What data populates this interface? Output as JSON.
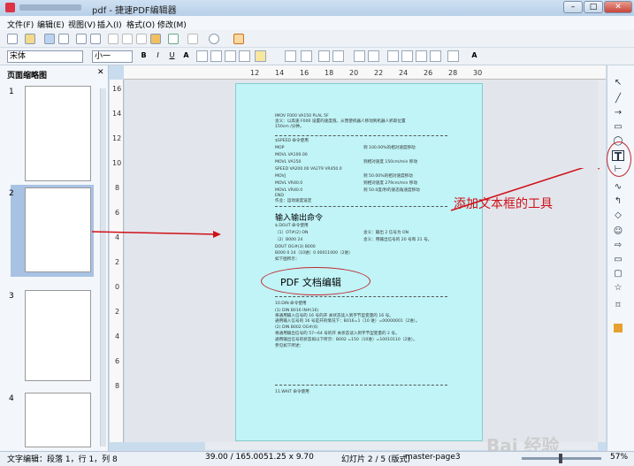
{
  "window": {
    "title": "pdf - 捷速PDF编辑器",
    "minimize": "–",
    "maximize": "□",
    "close": "✕"
  },
  "menu": [
    "文件(F)",
    "编辑(E)",
    "视图(V)",
    "插入(I)",
    "格式(O)",
    "修改(M)"
  ],
  "format": {
    "font": "宋体",
    "size": "小一",
    "bold": "B",
    "italic": "I",
    "underline": "U",
    "fontscale": "A"
  },
  "left_pane": {
    "title": "页面缩略图",
    "pages": [
      "1",
      "2",
      "3",
      "4"
    ],
    "selected": "2"
  },
  "ruler": {
    "h": [
      "12",
      "14",
      "16",
      "18",
      "20",
      "22",
      "24",
      "26",
      "28",
      "30"
    ],
    "v": [
      "16",
      "14",
      "12",
      "10",
      "8",
      "6",
      "4",
      "2",
      "0",
      "2",
      "4",
      "6",
      "8"
    ]
  },
  "page": {
    "heading": "输入输出命令",
    "pdf_text": "PDF 文档编辑",
    "lines_top": [
      "IMOV F000 VA150 PLAL 5F",
      "含义：以高速 F000 设置的速度值。从而使机器人移动到机器人抓取位置",
      "150cm /分钟。",
      "$SPEED 命令使用",
      "MOP",
      "MOVL VA100.00",
      "MOVL VA150",
      "SPEED VA200.00 VA279 VR450.0",
      "MOVJ",
      "MOVL VR40.0",
      "MOVL VR40.0",
      "END",
      "作业：运动速度设定"
    ],
    "right_col": [
      "到 100.00%的相对速度移动",
      "到相对速度 150cm/min 移动",
      "到 50.00%的相对速度移动",
      "到相对速度 279cm/min 移动",
      "到 50.0度/秒的姿态角速度移动"
    ],
    "lines_io": [
      "$.DOUT 命令使用",
      "（1）OT#(2) ON",
      "（2）B000 24",
      "DOUT OG#(3) B000",
      "B000 0 24（10进）0 00011000（2进）",
      "如下图所示："
    ],
    "io_right": [
      "含义：输出 2 信号为 ON",
      "含义：用输出信号的 20 号和 21 号。"
    ],
    "lines_bottom": [
      "10.DIN 命令使用",
      "(1) DIN B016 IN#(16)",
      "将通用输入信号的 16 号的开 关状态读入到字节型变量的 16 号。",
      "通用输入信号的 16 号是开的情况下：B016=1（10 进）=00000001（2进）。",
      "(2) DIN B002 OG#(6)",
      "将通用输出信号的 57~64 号的开 关状态读入到字节型变量的 2 号。",
      "通用输出信号的状态如以下所示：B002 =150（10进）=10010110（2进）。",
      "参见如下所述："
    ],
    "wait": "11.WAIT 命令使用"
  },
  "annotation": "添加文本框的工具",
  "status": {
    "mode": "文字编辑：段落 1，行 1，列 8",
    "pos": "39.00 / 165.00",
    "size": "51.25 x 9.70",
    "slide": "幻灯片 2 / 5 (版式)",
    "master": "master-page3",
    "zoom": "57%"
  },
  "watermark": "Bai 经验",
  "colors": {
    "page": "#c0f4f7",
    "annotation": "#d01018"
  }
}
